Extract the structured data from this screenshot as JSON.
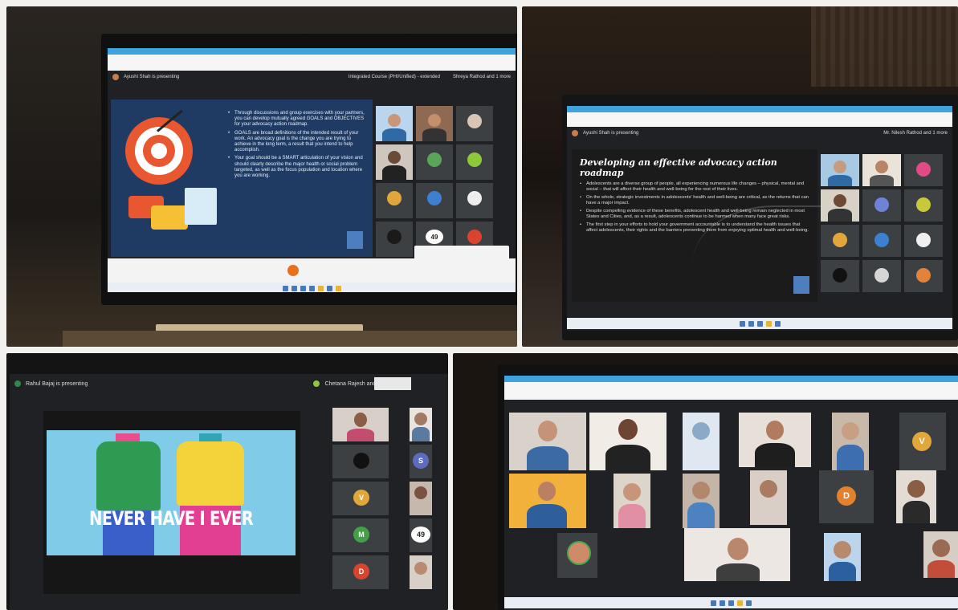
{
  "panel1": {
    "presenting_text": "Ayushi Shah is presenting",
    "meeting_name": "Integrated Course (PHI/Unified) - extended",
    "others_text": "Shreya Rathod and 1 more",
    "bullets": [
      "Through discussions and group exercises with your partners, you can develop mutually agreed GOALS and OBJECTIVES for your advocacy action roadmap.",
      "GOALS are broad definitions of the intended result of your work. An advocacy goal is the change you are trying to achieve in the long term, a result that you intend to help accomplish.",
      "Your goal should be a SMART articulation of your vision and should clearly describe the major health or social problem targeted, as well as the focus population and location where you are working."
    ],
    "tile_count": "49"
  },
  "panel2": {
    "presenting_text": "Ayushi Shah is presenting",
    "others_text": "Mr. Nilesh Rathod and 1 more",
    "slide_title": "Developing an effective advocacy action roadmap",
    "bullets": [
      "Adolescents are a diverse group of people, all experiencing numerous life changes – physical, mental and social – that will affect their health and well-being for the rest of their lives.",
      "On the whole, strategic investments in adolescents' health and well-being are critical, as the returns that can have a major impact.",
      "Despite compelling evidence of these benefits, adolescent health and well-being remain neglected in most States and Cities, and, as a result, adolescents continue to be harmed when many face great risks.",
      "The first step in your efforts to hold your government accountable is to understand the health issues that affect adolescents, their rights and the barriers preventing them from enjoying optimal health and well-being."
    ]
  },
  "panel3": {
    "presenting_text": "Rahul Bajaj is presenting",
    "others_text": "Chetana Rajesh and 3 more",
    "slide_text": "NEVER HAVE I EVER",
    "tile_count": "49",
    "avatars": [
      "S",
      "V",
      "M",
      "D"
    ]
  },
  "panel4": {
    "avatars": [
      "V",
      "D"
    ]
  },
  "colors": {
    "meet_bg": "#202124",
    "tile_bg": "#3c4043",
    "slide1_bg": "#1f3b63",
    "slide3_bg": "#7fcbe8",
    "accent_blue": "#3fa3e0"
  }
}
